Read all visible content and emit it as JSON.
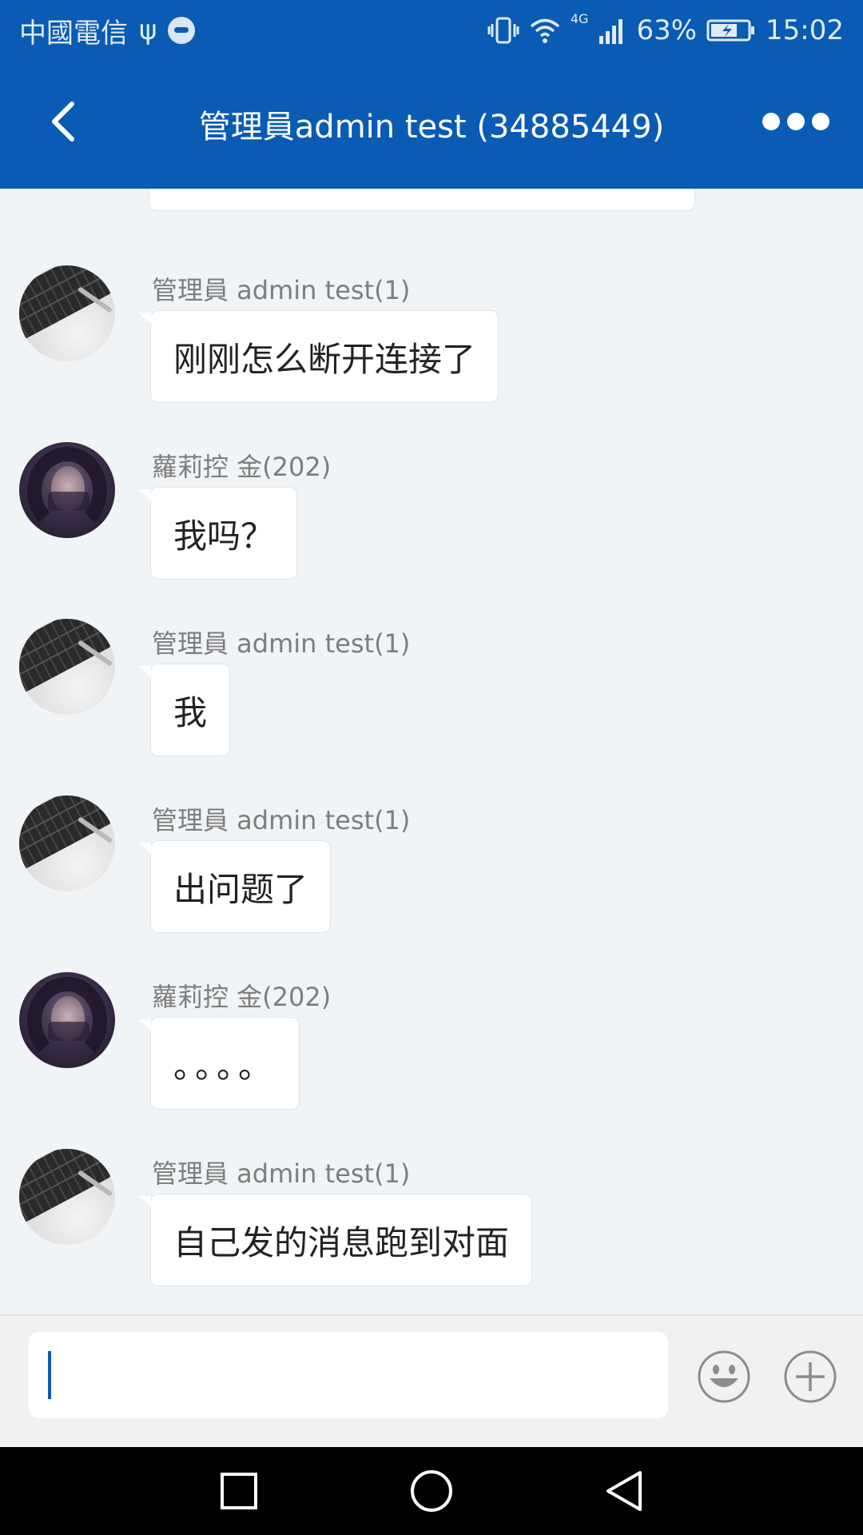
{
  "status_bar": {
    "carrier": "中國電信",
    "network": "4G",
    "battery": "63%",
    "time": "15:02"
  },
  "header": {
    "title": "管理員admin test (34885449)",
    "back_icon": "chevron-left-icon",
    "more_icon": "more-horizontal-icon"
  },
  "messages": [
    {
      "sender": "管理員 admin test(1)",
      "text": "刚刚怎么断开连接了",
      "avatar": "keyboard-avatar"
    },
    {
      "sender": "蘿莉控 金(202)",
      "text": "我吗？",
      "avatar": "girl-avatar"
    },
    {
      "sender": "管理員 admin test(1)",
      "text": "我",
      "avatar": "keyboard-avatar"
    },
    {
      "sender": "管理員 admin test(1)",
      "text": "出问题了",
      "avatar": "keyboard-avatar"
    },
    {
      "sender": "蘿莉控 金(202)",
      "text": "。。。。",
      "avatar": "girl-avatar"
    },
    {
      "sender": "管理員 admin test(1)",
      "text": "自己发的消息跑到对面",
      "avatar": "keyboard-avatar"
    }
  ],
  "composer": {
    "value": "",
    "emoji_icon": "emoji-icon",
    "plus_icon": "plus-icon"
  },
  "colors": {
    "primary": "#0a5bb3",
    "background": "#f1f4f6",
    "bubble": "#ffffff",
    "sender_text": "#7d7d7d"
  }
}
